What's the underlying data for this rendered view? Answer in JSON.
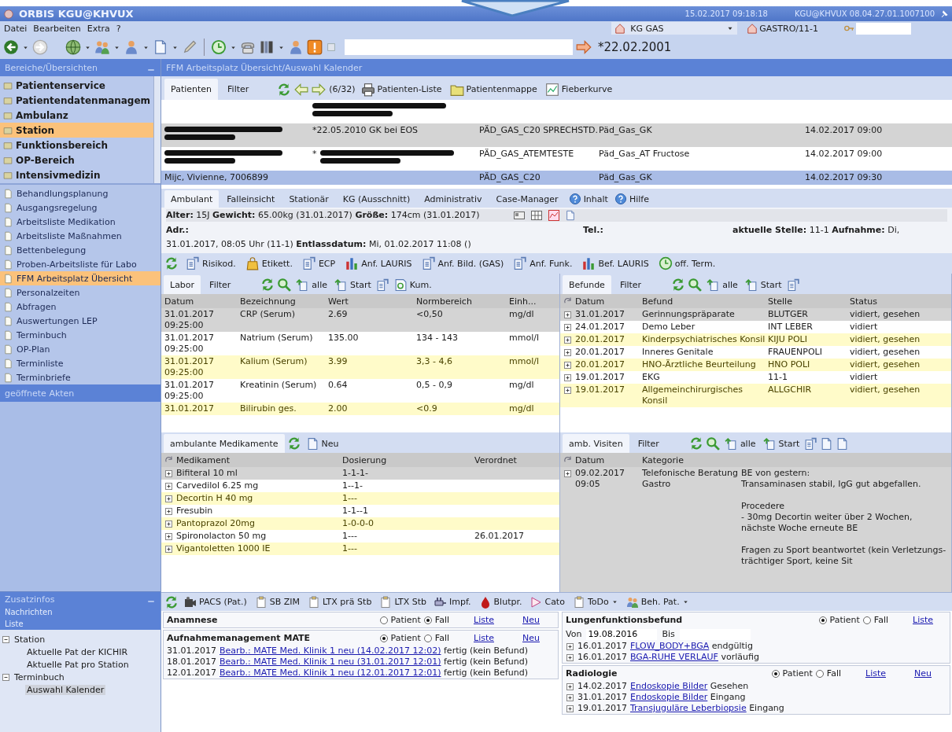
{
  "window": {
    "title": "ORBIS KGU@KHVUX",
    "datetime": "15.02.2017 09:18:18",
    "session": "KGU@KHVUX 08.04.27.01.1007100"
  },
  "menu": [
    "Datei",
    "Bearbeiten",
    "Extra",
    "?"
  ],
  "context": {
    "department": "KG GAS",
    "unit": "GASTRO/11-1",
    "birthdate": "*22.02.2001"
  },
  "sidebar": {
    "title": "Bereiche/Übersichten",
    "groups": [
      {
        "label": "Patientenservice",
        "selected": false
      },
      {
        "label": "Patientendatenmanagem",
        "selected": false
      },
      {
        "label": "Ambulanz",
        "selected": false
      },
      {
        "label": "Station",
        "selected": true
      },
      {
        "label": "Funktionsbereich",
        "selected": false
      },
      {
        "label": "OP-Bereich",
        "selected": false
      },
      {
        "label": "Intensivmedizin",
        "selected": false
      }
    ],
    "items": [
      {
        "label": "Behandlungsplanung",
        "selected": false
      },
      {
        "label": "Ausgangsregelung",
        "selected": false
      },
      {
        "label": "Arbeitsliste Medikation",
        "selected": false
      },
      {
        "label": "Arbeitsliste Maßnahmen",
        "selected": false
      },
      {
        "label": "Bettenbelegung",
        "selected": false
      },
      {
        "label": "Proben-Arbeitsliste für Labo",
        "selected": false
      },
      {
        "label": "FFM Arbeitsplatz Übersicht",
        "selected": true
      },
      {
        "label": "Personalzeiten",
        "selected": false
      },
      {
        "label": "Abfragen",
        "selected": false
      },
      {
        "label": "Auswertungen LEP",
        "selected": false
      },
      {
        "label": "Terminbuch",
        "selected": false
      },
      {
        "label": "OP-Plan",
        "selected": false
      },
      {
        "label": "Terminliste",
        "selected": false
      },
      {
        "label": "Terminbriefe",
        "selected": false
      }
    ],
    "open_files_title": "geöffnete Akten",
    "info_title": "Zusatzinfos",
    "info_links": [
      "Nachrichten",
      "Liste"
    ],
    "tree": [
      {
        "label": "Station",
        "expanded": true,
        "selected": false,
        "children": [
          {
            "label": "Aktuelle Pat der KICHIR",
            "selected": false
          },
          {
            "label": "Aktuelle Pat pro Station",
            "selected": false
          }
        ]
      },
      {
        "label": "Terminbuch",
        "expanded": true,
        "selected": false,
        "children": [
          {
            "label": "Auswahl Kalender",
            "selected": true
          }
        ]
      }
    ]
  },
  "workspace_title": "FFM Arbeitsplatz Übersicht/Auswahl Kalender",
  "patients": {
    "tabs": [
      {
        "label": "Patienten",
        "selected": true
      },
      {
        "label": "Filter",
        "selected": false
      }
    ],
    "counter": "(6/32)",
    "actions": [
      "Patienten-Liste",
      "Patientenmappe",
      "Fieberkurve"
    ],
    "rows": [
      {
        "selected": false,
        "highlighted": false,
        "cells": [
          {
            "kind": "blank"
          },
          {
            "kind": "redacted"
          },
          {
            "kind": "blank"
          },
          {
            "kind": "blank"
          },
          {
            "kind": "blank"
          }
        ]
      },
      {
        "selected": false,
        "highlighted": true,
        "cells": [
          {
            "kind": "redacted"
          },
          {
            "kind": "text",
            "text": "*22.05.2010 GK bei EOS"
          },
          {
            "kind": "text",
            "text": "PÄD_GAS_C20 SPRECHSTD."
          },
          {
            "kind": "text",
            "text": "Päd_Gas_GK"
          },
          {
            "kind": "text",
            "text": "14.02.2017 09:00"
          }
        ]
      },
      {
        "selected": false,
        "highlighted": false,
        "cells": [
          {
            "kind": "redacted"
          },
          {
            "kind": "redacted",
            "prefix": "*"
          },
          {
            "kind": "text",
            "text": "PÄD_GAS_ATEMTESTE"
          },
          {
            "kind": "text",
            "text": "Päd_Gas_AT Fructose"
          },
          {
            "kind": "text",
            "text": "14.02.2017 09:00"
          }
        ]
      },
      {
        "selected": true,
        "highlighted": false,
        "cells": [
          {
            "kind": "text",
            "text": "Mijc, Vivienne, 7006899"
          },
          {
            "kind": "blank"
          },
          {
            "kind": "text",
            "text": "PÄD_GAS_C20"
          },
          {
            "kind": "text",
            "text": "Päd_Gas_GK"
          },
          {
            "kind": "text",
            "text": "14.02.2017 09:30"
          }
        ]
      }
    ]
  },
  "case_tabs": [
    {
      "label": "Ambulant",
      "selected": true
    },
    {
      "label": "Falleinsicht",
      "selected": false
    },
    {
      "label": "Stationär",
      "selected": false
    },
    {
      "label": "KG (Ausschnitt)",
      "selected": false
    },
    {
      "label": "Administrativ",
      "selected": false
    },
    {
      "label": "Case-Manager",
      "selected": false
    }
  ],
  "help_links": [
    "Inhalt",
    "Hilfe"
  ],
  "summary": {
    "vitals": "**Alter:** 15J **Gewicht:** 65.00kg (31.01.2017) **Größe:** 174cm (31.01.2017)",
    "address": "Adr.:",
    "phone": "Tel.:",
    "location": "**aktuelle Stelle:** 11-1 **Aufnahme:** Di,",
    "admission": "31.01.2017, 08:05 Uhr (11-1) **Entlassdatum:** Mi, 01.02.2017 11:08 ()"
  },
  "actions": [
    "Risikod.",
    "Etikett.",
    "ECP",
    "Anf. LAURIS",
    "Anf. Bild. (GAS)",
    "Anf. Funk.",
    "Bef. LAURIS",
    "off. Term."
  ],
  "labor": {
    "tabs": [
      {
        "label": "Labor",
        "selected": true
      },
      {
        "label": "Filter",
        "selected": false
      }
    ],
    "tools": [
      "alle",
      "Start",
      "Kum."
    ],
    "columns": [
      "Datum",
      "Bezeichnung",
      "Wert",
      "Normbereich",
      "Einh..."
    ],
    "rows": [
      {
        "selected": true,
        "highlighted": false,
        "cells": [
          "31.01.2017 09:25:00",
          "CRP (Serum)",
          "2.69",
          "<0,50",
          "mg/dl"
        ]
      },
      {
        "selected": false,
        "highlighted": false,
        "cells": [
          "31.01.2017 09:25:00",
          "Natrium (Serum)",
          "135.00",
          "134 - 143",
          "mmol/l"
        ]
      },
      {
        "selected": false,
        "highlighted": true,
        "cells": [
          "31.01.2017 09:25:00",
          "Kalium (Serum)",
          "3.99",
          "3,3 - 4,6",
          "mmol/l"
        ]
      },
      {
        "selected": false,
        "highlighted": false,
        "cells": [
          "31.01.2017 09:25:00",
          "Kreatinin (Serum)",
          "0.64",
          "0,5 - 0,9",
          "mg/dl"
        ]
      },
      {
        "selected": false,
        "highlighted": true,
        "cells": [
          "31.01.2017",
          "Bilirubin ges.",
          "2.00",
          "<0.9",
          "mg/dl"
        ]
      }
    ]
  },
  "befunde": {
    "tabs": [
      {
        "label": "Befunde",
        "selected": true
      },
      {
        "label": "Filter",
        "selected": false
      }
    ],
    "tools": [
      "alle",
      "Start"
    ],
    "columns": [
      "Datum",
      "Befund",
      "Stelle",
      "Status"
    ],
    "rows": [
      {
        "selected": true,
        "highlighted": false,
        "cells": [
          "31.01.2017",
          "Gerinnungspräparate",
          "BLUTGER",
          "vidiert, gesehen"
        ]
      },
      {
        "selected": false,
        "highlighted": false,
        "cells": [
          "24.01.2017",
          "Demo Leber",
          "INT LEBER",
          "vidiert"
        ]
      },
      {
        "selected": false,
        "highlighted": true,
        "cells": [
          "20.01.2017",
          "Kinderpsychiatrisches Konsil",
          "KIJU POLI",
          "vidiert, gesehen"
        ]
      },
      {
        "selected": false,
        "highlighted": false,
        "cells": [
          "20.01.2017",
          "Inneres Genitale",
          "FRAUENPOLI",
          "vidiert, gesehen"
        ]
      },
      {
        "selected": false,
        "highlighted": true,
        "cells": [
          "20.01.2017",
          "HNO-Ärztliche Beurteilung",
          "HNO POLI",
          "vidiert, gesehen"
        ]
      },
      {
        "selected": false,
        "highlighted": false,
        "cells": [
          "19.01.2017",
          "EKG",
          "11-1",
          "vidiert"
        ]
      },
      {
        "selected": false,
        "highlighted": true,
        "cells": [
          "19.01.2017",
          "Allgemeinchirurgisches Konsil",
          "ALLGCHIR",
          "vidiert, gesehen"
        ]
      }
    ]
  },
  "medications": {
    "tabs": [
      {
        "label": "ambulante Medikamente",
        "selected": true
      }
    ],
    "tools": [
      "Neu"
    ],
    "columns": [
      "Medikament",
      "Dosierung",
      "Verordnet"
    ],
    "rows": [
      {
        "selected": true,
        "highlighted": false,
        "cells": [
          "Bifiteral 10 ml",
          "1-1-1-",
          ""
        ]
      },
      {
        "selected": false,
        "highlighted": false,
        "cells": [
          "Carvedilol 6.25 mg",
          "1--1-"
        ]
      },
      {
        "selected": false,
        "highlighted": true,
        "cells": [
          "Decortin H 40 mg",
          "1---"
        ]
      },
      {
        "selected": false,
        "highlighted": false,
        "cells": [
          "Fresubin",
          "1-1--1"
        ]
      },
      {
        "selected": false,
        "highlighted": true,
        "cells": [
          "Pantoprazol 20mg",
          "1-0-0-0"
        ]
      },
      {
        "selected": false,
        "highlighted": false,
        "cells": [
          "Spironolacton 50 mg",
          "1---",
          "26.01.2017"
        ]
      },
      {
        "selected": false,
        "highlighted": true,
        "cells": [
          "Vigantoletten 1000 IE",
          "1---"
        ]
      }
    ]
  },
  "visits": {
    "tabs": [
      {
        "label": "amb. Visiten",
        "selected": true
      },
      {
        "label": "Filter",
        "selected": false
      }
    ],
    "tools": [
      "alle",
      "Start"
    ],
    "columns": [
      "Datum",
      "Kategorie"
    ],
    "rows": [
      {
        "selected": true,
        "date": "09.02.2017 09:05",
        "category": "Telefonische Beratung Gastro",
        "note": [
          [
            "BE von gestern:",
            "Transaminasen stabil, IgG gut abgefallen."
          ],
          [
            "Procedere",
            "- 30mg Decortin weiter über 2 Wochen, nächste Woche erneute BE"
          ],
          [
            "Fragen zu Sport beantwortet (kein Verletzungs-trächtiger Sport, keine Sit"
          ]
        ]
      }
    ]
  },
  "bottom_toolbar": [
    {
      "label": "PACS (Pat.)",
      "menu": false
    },
    {
      "label": "SB ZIM",
      "menu": false
    },
    {
      "label": "LTX prä Stb",
      "menu": false
    },
    {
      "label": "LTX Stb",
      "menu": false
    },
    {
      "label": "Impf.",
      "menu": false
    },
    {
      "label": "Blutpr.",
      "menu": false
    },
    {
      "label": "Cato",
      "menu": false
    },
    {
      "label": "ToDo",
      "menu": true
    },
    {
      "label": "Beh. Pat.",
      "menu": true
    }
  ],
  "widgets": {
    "left": [
      {
        "title": "Anamnese",
        "options": [
          {
            "label": "Patient",
            "selected": false
          },
          {
            "label": "Fall",
            "selected": true
          }
        ],
        "links": [
          "Liste",
          "Neu"
        ]
      },
      {
        "title": "Aufnahmemanagement MATE",
        "options": [
          {
            "label": "Patient",
            "selected": true
          },
          {
            "label": "Fall",
            "selected": false
          }
        ],
        "links": [
          "Liste",
          "Neu"
        ],
        "entries": [
          {
            "expandable": false,
            "date": "31.01.2017",
            "link": "Bearb.: MATE Med. Klinik 1 neu (14.02.2017 12:02)",
            "status": "fertig (kein Befund)"
          },
          {
            "expandable": false,
            "date": "18.01.2017",
            "link": "Bearb.: MATE Med. Klinik 1 neu (31.01.2017 12:01)",
            "status": "fertig (kein Befund)"
          },
          {
            "expandable": false,
            "date": "12.01.2017",
            "link": "Bearb.: MATE Med. Klinik 1 neu (12.01.2017 12:01)",
            "status": "fertig (kein Befund)"
          }
        ]
      }
    ],
    "right": [
      {
        "title": "Lungenfunktionsbefund",
        "options": [
          {
            "label": "Patient",
            "selected": true
          },
          {
            "label": "Fall",
            "selected": false
          }
        ],
        "links": [
          "Liste"
        ],
        "range": {
          "from_label": "Von",
          "from": "19.08.2016",
          "to_label": "Bis"
        },
        "entries": [
          {
            "expandable": true,
            "date": "16.01.2017",
            "link": "FLOW_BODY+BGA",
            "status": "endgültig"
          },
          {
            "expandable": true,
            "date": "16.01.2017",
            "link": "BGA-RUHE VERLAUF",
            "status": "vorläufig"
          }
        ]
      },
      {
        "title": "Radiologie",
        "options": [
          {
            "label": "Patient",
            "selected": true
          },
          {
            "label": "Fall",
            "selected": false
          }
        ],
        "links": [
          "Liste",
          "Neu"
        ],
        "entries": [
          {
            "expandable": true,
            "date": "14.02.2017",
            "link": "Endoskopie Bilder",
            "status": "Gesehen"
          },
          {
            "expandable": true,
            "date": "31.01.2017",
            "link": "Endoskopie Bilder",
            "status": "Eingang"
          },
          {
            "expandable": true,
            "date": "19.01.2017",
            "link": "Transjuguläre Leberbiopsie",
            "status": "Eingang"
          }
        ]
      }
    ]
  }
}
